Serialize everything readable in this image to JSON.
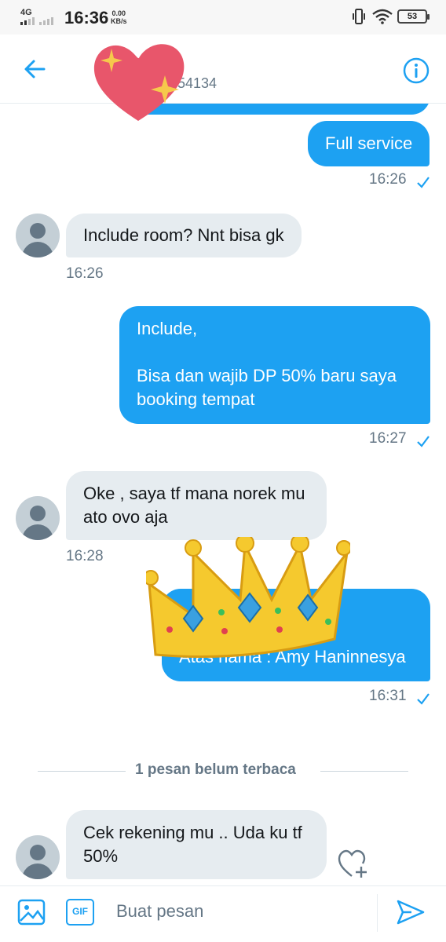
{
  "status_bar": {
    "network": "4G",
    "time": "16:36",
    "speed_value": "0.00",
    "speed_unit": "KB/s",
    "battery": "53"
  },
  "header": {
    "title_partial": "54134",
    "back_icon": "arrow-left-icon",
    "info_icon": "info-circle-icon"
  },
  "messages": [
    {
      "side": "out",
      "text": "Full service",
      "time": "16:26"
    },
    {
      "side": "in",
      "text": "Include room? Nnt bisa gk",
      "time": "16:26"
    },
    {
      "side": "out",
      "text": "Include,\n\nBisa dan wajib DP 50% baru saya booking tempat",
      "time": "16:27"
    },
    {
      "side": "in",
      "text": "Oke , saya tf mana norek mu\nato ovo aja",
      "time": "16:28"
    },
    {
      "side": "out",
      "text": "Atas nama : Amy Haninnesya",
      "time": "16:31"
    },
    {
      "side": "in",
      "text": "Cek rekening mu .. Uda ku tf\n50%",
      "time": ""
    }
  ],
  "unread_divider": "1 pesan belum terbaca",
  "composer": {
    "placeholder": "Buat pesan",
    "gif_label": "GIF",
    "media_icon": "image-icon",
    "send_icon": "send-icon"
  },
  "colors": {
    "accent": "#1da1f2",
    "incoming_bubble": "#e6ecf0",
    "secondary_text": "#657786"
  }
}
